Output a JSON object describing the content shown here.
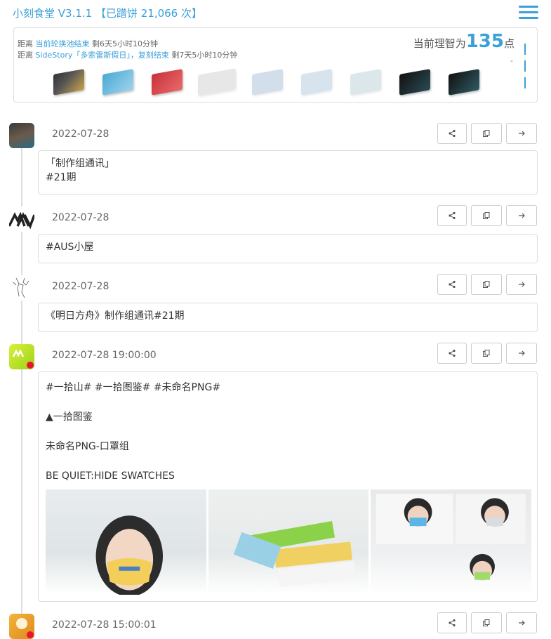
{
  "header": {
    "title": "小刻食堂 V3.1.1 【已蹭饼 21,066 次】"
  },
  "infobox": {
    "countdown1": {
      "prefix": "距离 ",
      "event": "当前轮换池结束",
      "remaining": " 剩6天5小时10分钟"
    },
    "countdown2": {
      "prefix": "距离 ",
      "event": "SideStory「多索雷斯假日」，复刻结束",
      "remaining": " 剩7天5小时10分钟"
    },
    "sanity_prefix": "当前理智为",
    "sanity_value": "135",
    "sanity_suffix": "点",
    "dash": "-",
    "item_icons": [
      "exp-card-icon",
      "purchase-certificate-icon",
      "red-ticket-icon",
      "gray-device-icon",
      "faded-card-icon",
      "faded-card-icon",
      "faded-card-icon",
      "dark-teal-chip-icon",
      "dark-teal-chip-icon"
    ]
  },
  "posts": [
    {
      "avatar": "arknights-character-avatar",
      "date": "2022-07-28",
      "lines": [
        "「制作组通讯」",
        "#21期"
      ]
    },
    {
      "avatar": "mountain-logo-avatar",
      "date": "2022-07-28",
      "lines": [
        "#AUS小屋"
      ]
    },
    {
      "avatar": "deer-sketch-avatar",
      "date": "2022-07-28",
      "lines": [
        "《明日方舟》制作组通讯#21期"
      ]
    },
    {
      "avatar": "mountain-weibo-avatar",
      "date": "2022-07-28 19:00:00",
      "lines": [
        "#一拾山# #一拾图鉴# #未命名PNG#",
        "▲一拾图鉴",
        "未命名PNG-口罩组",
        "BE QUIET:HIDE SWATCHES"
      ]
    },
    {
      "avatar": "cooking-weibo-avatar",
      "date": "2022-07-28 15:00:01",
      "lines": []
    }
  ],
  "colors": {
    "accent": "#3aa0d8",
    "border": "#dddddd"
  }
}
